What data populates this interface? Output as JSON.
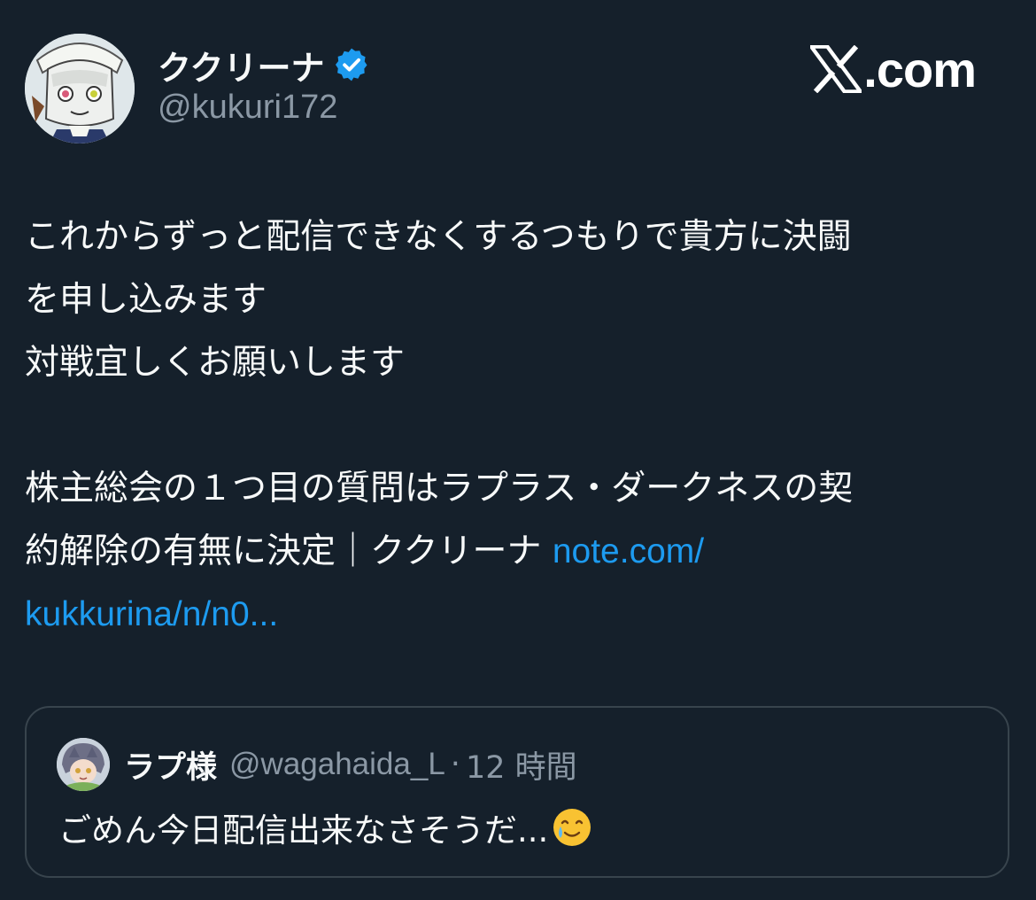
{
  "author": {
    "display_name": "ククリーナ",
    "handle": "@kukuri172",
    "verified": true,
    "avatar_icon": "character-avatar"
  },
  "brand": {
    "text": ".com",
    "logo_icon": "x-logo-icon"
  },
  "tweet": {
    "lines": [
      "これからずっと配信できなくするつもりで貴方に決闘",
      "を申し込みます",
      "対戦宜しくお願いします",
      "",
      "株主総会の１つ目の質問はラプラス・ダークネスの契",
      "約解除の有無に決定｜ククリーナ "
    ],
    "link_part1": "note.com/",
    "link_part2": "kukkurina/n/n0..."
  },
  "quote": {
    "display_name": "ラプ様",
    "handle": "@wagahaida_L",
    "separator": "·",
    "time": "12 時間",
    "text": "ごめん今日配信出来なさそうだ...",
    "emoji": "smiling-face-with-tear"
  },
  "colors": {
    "background": "#15202b",
    "text": "#f7f9f9",
    "secondary": "#8b98a5",
    "link": "#1d9bf0",
    "border": "#38444d",
    "verified": "#1d9bf0"
  }
}
